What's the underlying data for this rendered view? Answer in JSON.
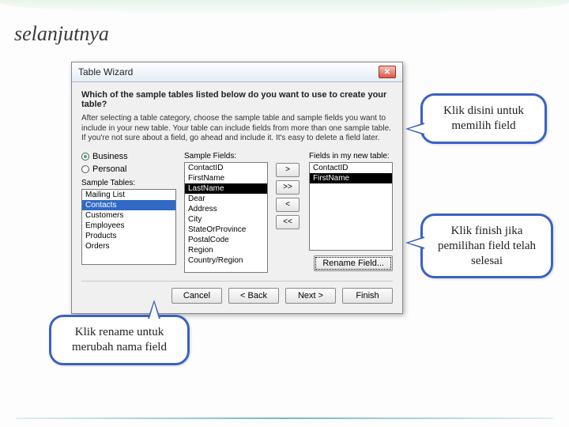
{
  "slide": {
    "title": "selanjutnya"
  },
  "dialog": {
    "title": "Table Wizard",
    "prompt": "Which of the sample tables listed below do you want to use to create your table?",
    "description": "After selecting a table category, choose the sample table and sample fields you want to include in your new table. Your table can include fields from more than one sample table. If you're not sure about a field, go ahead and include it. It's easy to delete a field later.",
    "category": {
      "business": "Business",
      "personal": "Personal",
      "selected": "business"
    },
    "labels": {
      "sample_tables": "Sample Tables:",
      "sample_fields": "Sample Fields:",
      "fields_in_table": "Fields in my new table:"
    },
    "sample_tables": [
      "Mailing List",
      "Contacts",
      "Customers",
      "Employees",
      "Products",
      "Orders"
    ],
    "sample_tables_selected": "Contacts",
    "sample_fields": [
      "ContactID",
      "FirstName",
      "LastName",
      "Dear",
      "Address",
      "City",
      "StateOrProvince",
      "PostalCode",
      "Region",
      "Country/Region"
    ],
    "sample_fields_highlight": "LastName",
    "new_fields": [
      "ContactID",
      "FirstName"
    ],
    "new_fields_highlight": "FirstName",
    "movers": {
      "add": ">",
      "add_all": ">>",
      "remove": "<",
      "remove_all": "<<"
    },
    "rename_btn": "Rename Field...",
    "nav": {
      "cancel": "Cancel",
      "back": "< Back",
      "next": "Next >",
      "finish": "Finish"
    }
  },
  "callouts": {
    "c1": "Klik disini untuk memilih field",
    "c2": "Klik finish jika pemilihan field telah selesai",
    "c3": "Klik rename untuk merubah nama field"
  }
}
